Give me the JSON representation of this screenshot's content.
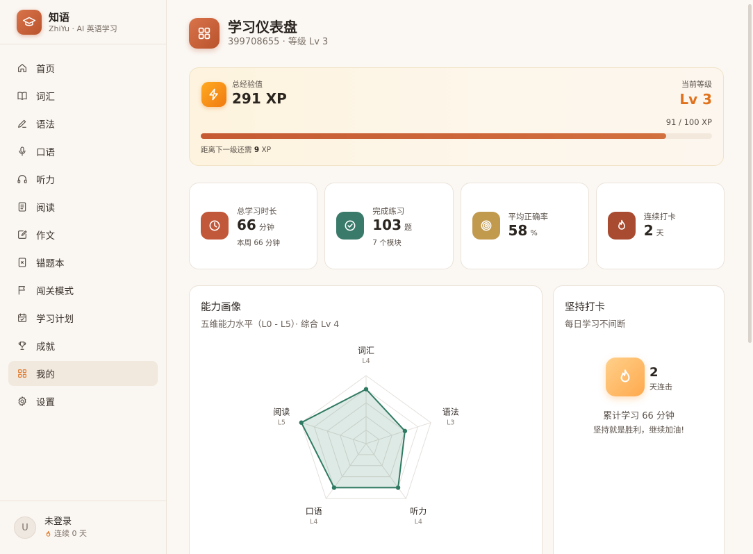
{
  "brand": {
    "name": "知语",
    "subtitle": "ZhiYu · AI 英语学习"
  },
  "nav": [
    {
      "label": "首页",
      "icon": "home-icon"
    },
    {
      "label": "词汇",
      "icon": "book-icon"
    },
    {
      "label": "语法",
      "icon": "pencil-icon"
    },
    {
      "label": "口语",
      "icon": "mic-icon"
    },
    {
      "label": "听力",
      "icon": "headphones-icon"
    },
    {
      "label": "阅读",
      "icon": "document-icon"
    },
    {
      "label": "作文",
      "icon": "edit-icon"
    },
    {
      "label": "错题本",
      "icon": "mistake-book-icon"
    },
    {
      "label": "闯关模式",
      "icon": "flag-icon"
    },
    {
      "label": "学习计划",
      "icon": "calendar-icon"
    },
    {
      "label": "成就",
      "icon": "trophy-icon"
    },
    {
      "label": "我的",
      "icon": "grid-icon",
      "active": true
    },
    {
      "label": "设置",
      "icon": "gear-icon"
    }
  ],
  "user": {
    "avatar": "U",
    "name": "未登录",
    "streak": "连续 0 天"
  },
  "header": {
    "title": "学习仪表盘",
    "subtitle": "399708655 · 等级 Lv 3"
  },
  "xp": {
    "label": "总经验值",
    "value": "291 XP",
    "level_label": "当前等级",
    "level_value": "Lv 3",
    "progress_text": "91 / 100 XP",
    "progress": 0.91,
    "remain_prefix": "距离下一级还需",
    "remain_value": "9",
    "remain_suffix": "XP"
  },
  "stats": [
    {
      "label": "总学习时长",
      "value": "66",
      "unit": "分钟",
      "sub": "本周 66 分钟",
      "icon": "clock-icon",
      "color": "#c2583a"
    },
    {
      "label": "完成练习",
      "value": "103",
      "unit": "题",
      "sub": "7 个模块",
      "icon": "check-circle-icon",
      "color": "#3a7a6a"
    },
    {
      "label": "平均正确率",
      "value": "58",
      "unit": "%",
      "sub": "",
      "icon": "target-icon",
      "color": "#c29a4e"
    },
    {
      "label": "连续打卡",
      "value": "2",
      "unit": "天",
      "sub": "",
      "icon": "flame-icon",
      "color": "#a94b30"
    }
  ],
  "radar": {
    "title": "能力画像",
    "subtitle": "五维能力水平（L0 - L5）· 综合 Lv 4",
    "max": 5,
    "axes": [
      {
        "name": "词汇",
        "level": "L4",
        "value": 4
      },
      {
        "name": "语法",
        "level": "L3",
        "value": 3
      },
      {
        "name": "听力",
        "level": "L4",
        "value": 4
      },
      {
        "name": "口语",
        "level": "L4",
        "value": 4
      },
      {
        "name": "阅读",
        "level": "L5",
        "value": 5
      }
    ],
    "accent": "#2f7a62"
  },
  "streak": {
    "title": "坚持打卡",
    "subtitle": "每日学习不间断",
    "count": "2",
    "count_label": "天连击",
    "total": "累计学习 66 分钟",
    "message": "坚持就是胜利，继续加油!"
  }
}
